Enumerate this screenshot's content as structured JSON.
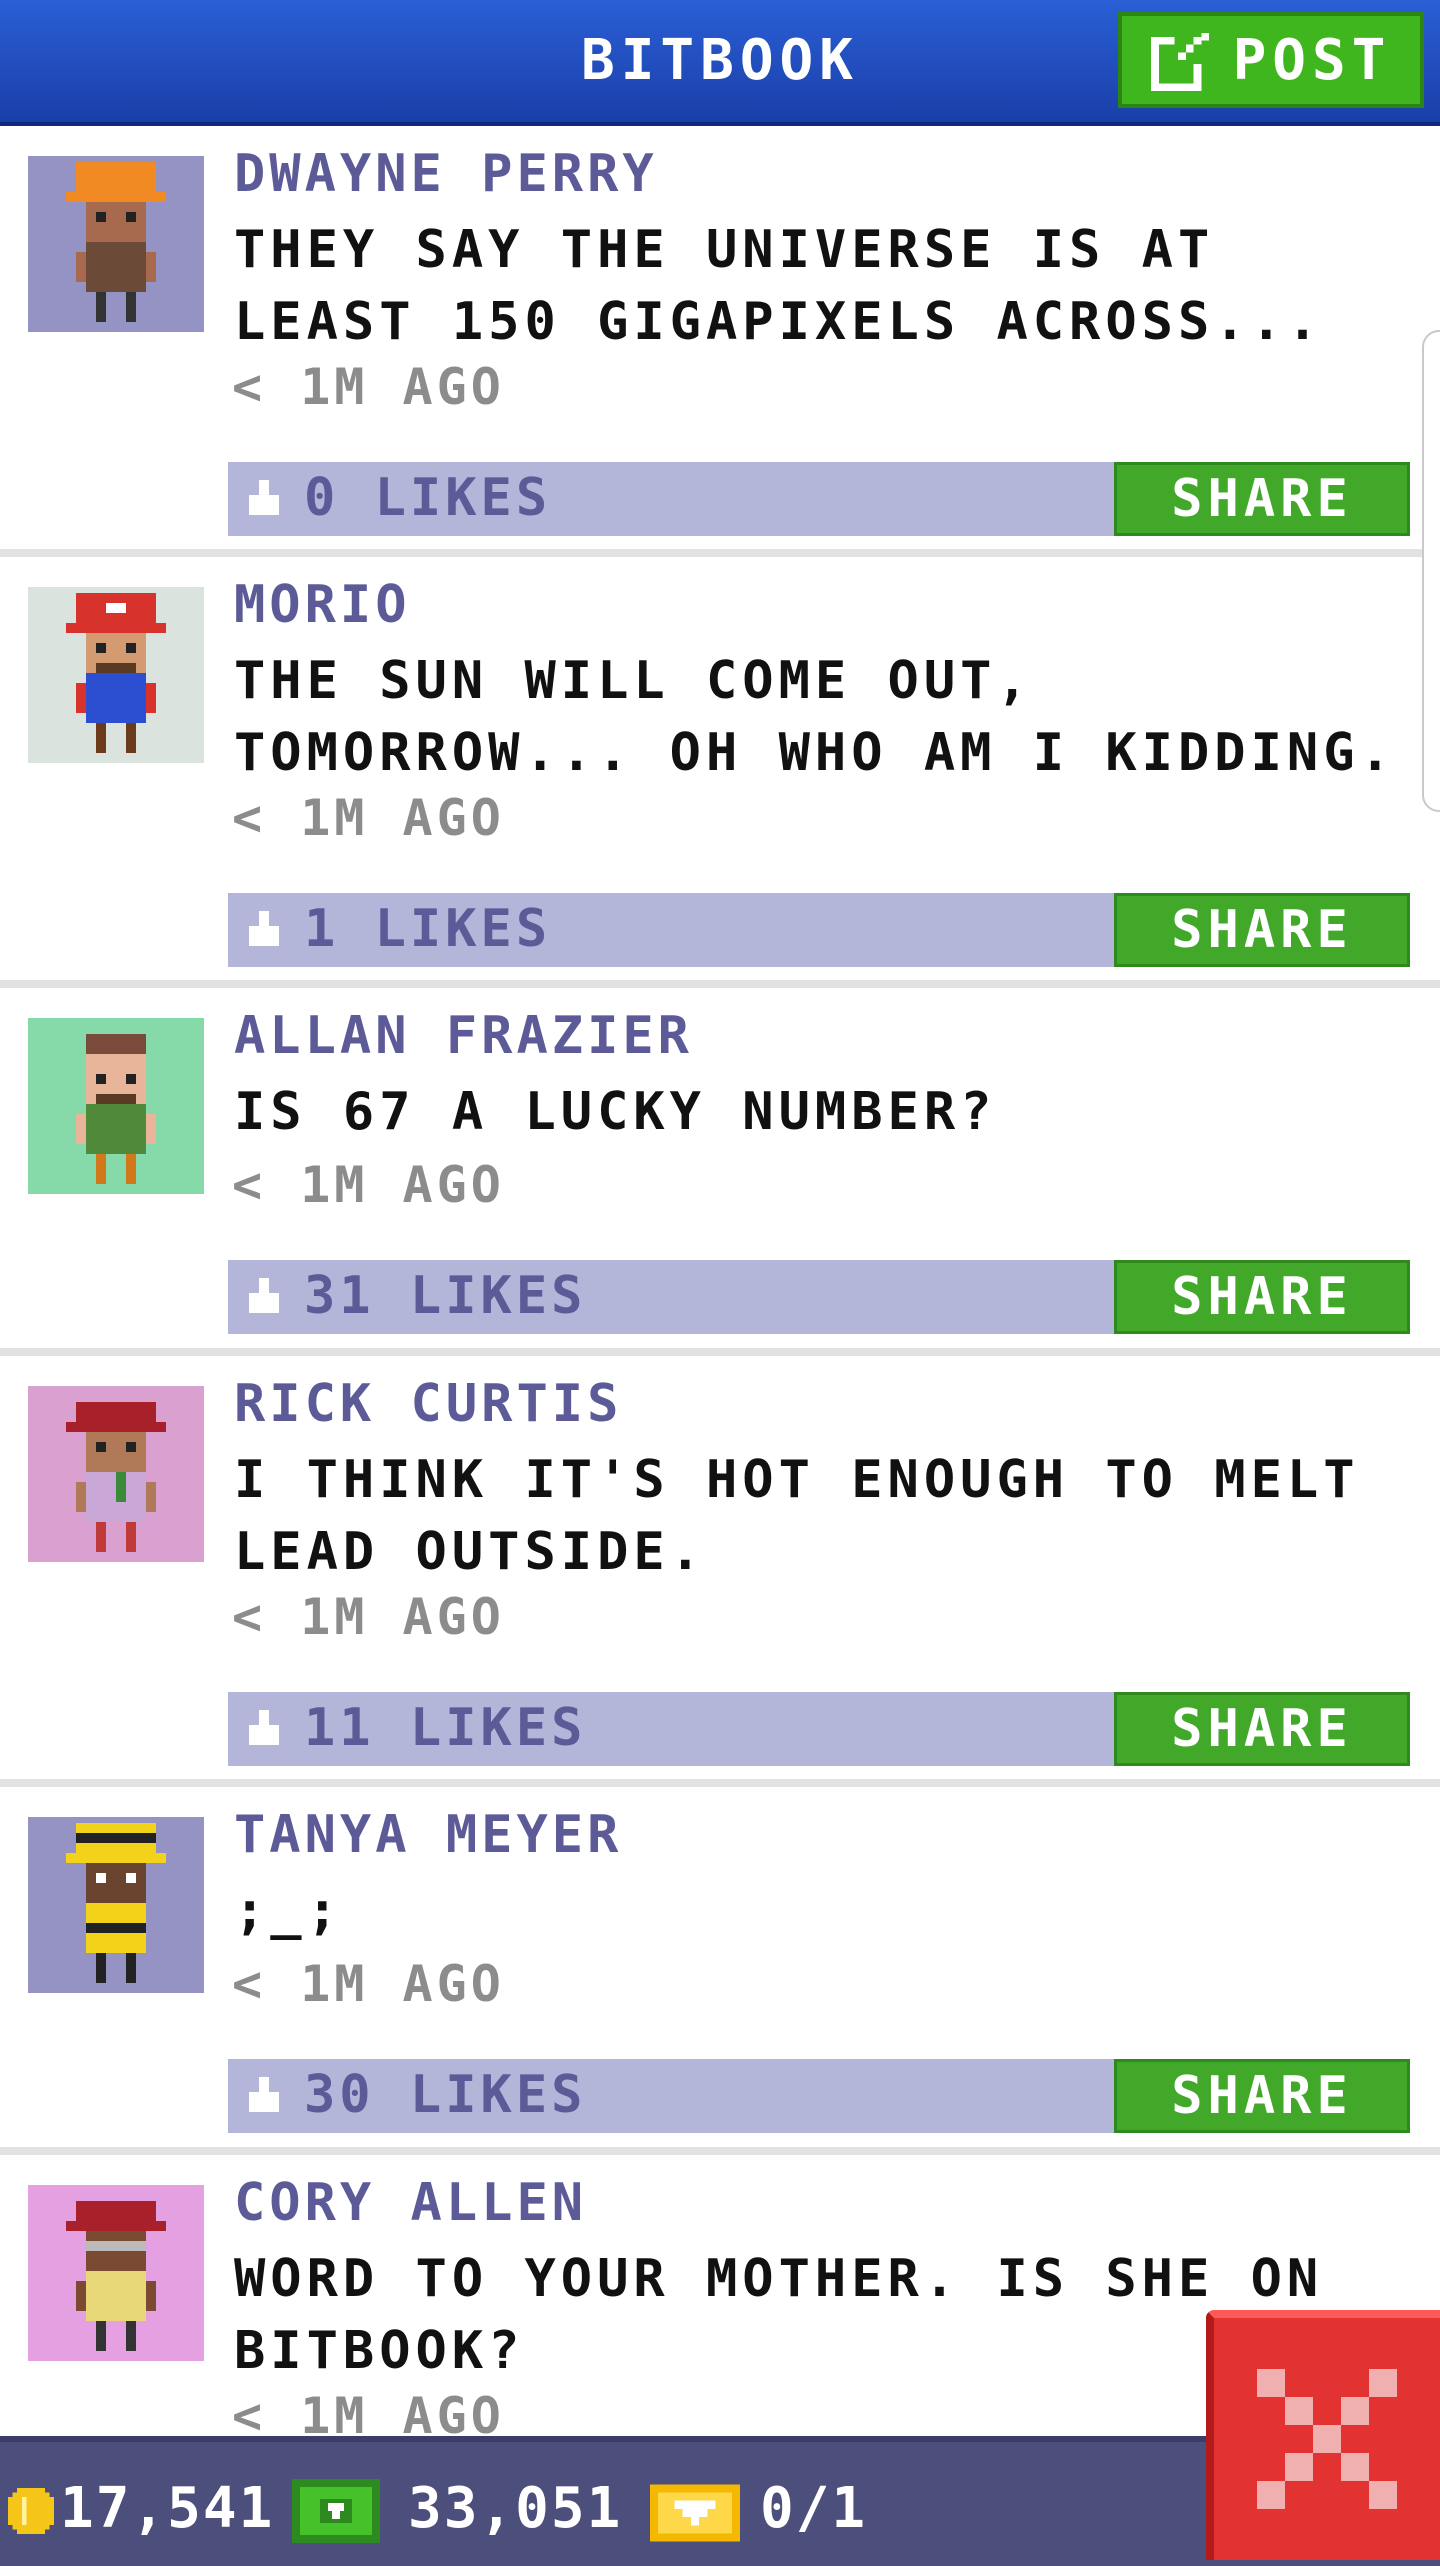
{
  "header": {
    "title": "BITBOOK",
    "post_label": "POST"
  },
  "posts": [
    {
      "author": "DWAYNE PERRY",
      "text": "THEY SAY THE UNIVERSE IS AT LEAST 150 GIGAPIXELS ACROSS...",
      "time": "< 1M AGO",
      "likes": "0 LIKES",
      "share": "SHARE",
      "avatar_bg": "#9592c4",
      "shirt": "#6b4a38",
      "hat": "#f28a24",
      "skin": "#a86a4e"
    },
    {
      "author": "MORIO",
      "text": "THE SUN WILL COME OUT, TOMORROW... OH WHO AM I KIDDING.",
      "time": "< 1M AGO",
      "likes": "1 LIKES",
      "share": "SHARE",
      "avatar_bg": "#dbe3df",
      "shirt": "#2b4fd0",
      "hat": "#d8322c",
      "skin": "#d49a72"
    },
    {
      "author": "ALLAN FRAZIER",
      "text": "IS 67 A LUCKY NUMBER?",
      "time": "< 1M AGO",
      "likes": "31 LIKES",
      "share": "SHARE",
      "avatar_bg": "#86d9a8",
      "shirt": "#4f8a3a",
      "hat": "#7a4a3a",
      "skin": "#e8b49a"
    },
    {
      "author": "RICK CURTIS",
      "text": "I THINK IT'S HOT ENOUGH TO MELT LEAD OUTSIDE.",
      "time": "< 1M AGO",
      "likes": "11 LIKES",
      "share": "SHARE",
      "avatar_bg": "#d9a0d0",
      "shirt": "#c9a8d8",
      "hat": "#a8202a",
      "skin": "#b07a58"
    },
    {
      "author": "TANYA MEYER",
      "text": ";_;",
      "time": "< 1M AGO",
      "likes": "30 LIKES",
      "share": "SHARE",
      "avatar_bg": "#9592c4",
      "shirt": "#f2d31a",
      "hat": "#f2d31a",
      "skin": "#6a442e"
    },
    {
      "author": "CORY ALLEN",
      "text": "WORD TO YOUR MOTHER. IS SHE ON BITBOOK?",
      "time": "< 1M AGO",
      "likes": "",
      "share": "",
      "avatar_bg": "#e4a0e0",
      "shirt": "#e8d878",
      "hat": "#a8202a",
      "skin": "#7a4a32"
    }
  ],
  "footer": {
    "coins": "17,541",
    "cash": "33,051",
    "tickets": "0/1"
  },
  "colors": {
    "header_blue": "#2a5fd6",
    "post_green": "#3fb51e",
    "likes_bar": "#b3b5d9",
    "author_purple": "#5c5b98",
    "close_red": "#e23232"
  },
  "icons": {
    "post": "edit-icon",
    "thumb": "thumbs-up-icon",
    "coin": "coin-icon",
    "cash": "bux-icon",
    "ticket": "ticket-icon",
    "close": "close-icon"
  }
}
